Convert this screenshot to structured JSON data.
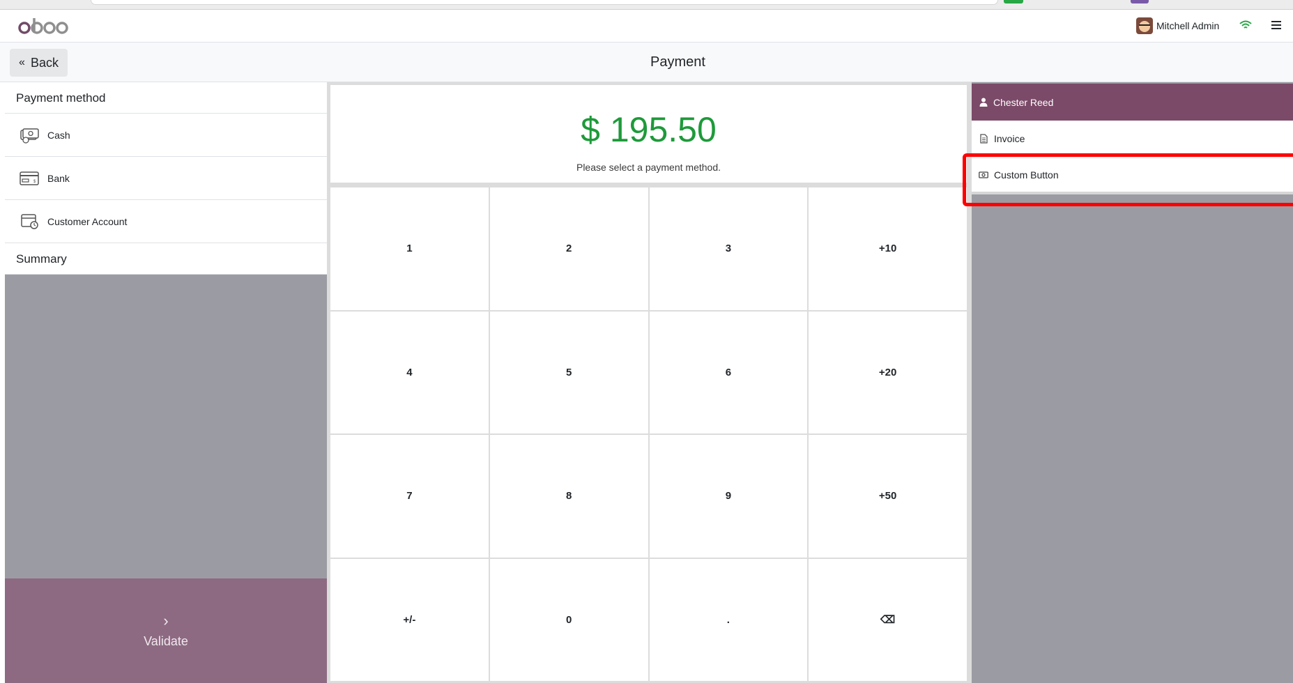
{
  "header": {
    "logo_text": "odoo",
    "user_name": "Mitchell Admin",
    "wifi_icon": "wifi-icon",
    "menu_icon": "hamburger-menu-icon"
  },
  "control_bar": {
    "back_label": "Back",
    "title": "Payment"
  },
  "left_panel": {
    "payment_method_header": "Payment method",
    "payment_methods": [
      {
        "label": "Cash",
        "icon": "cash-icon"
      },
      {
        "label": "Bank",
        "icon": "bank-card-icon"
      },
      {
        "label": "Customer Account",
        "icon": "customer-account-icon"
      }
    ],
    "summary_header": "Summary",
    "validate_label": "Validate"
  },
  "center": {
    "amount": "$ 195.50",
    "hint": "Please select a payment method.",
    "numpad_keys": [
      "1",
      "2",
      "3",
      "+10",
      "4",
      "5",
      "6",
      "+20",
      "7",
      "8",
      "9",
      "+50",
      "+/-",
      "0",
      ".",
      "⌫"
    ]
  },
  "right_panel": {
    "customer_name": "Chester Reed",
    "invoice_label": "Invoice",
    "custom_button_label": "Custom Button"
  },
  "colors": {
    "accent": "#7b4a68",
    "amount_green": "#1e9a3a",
    "validate_bg": "#8d6a82",
    "highlight": "#ff0000"
  }
}
